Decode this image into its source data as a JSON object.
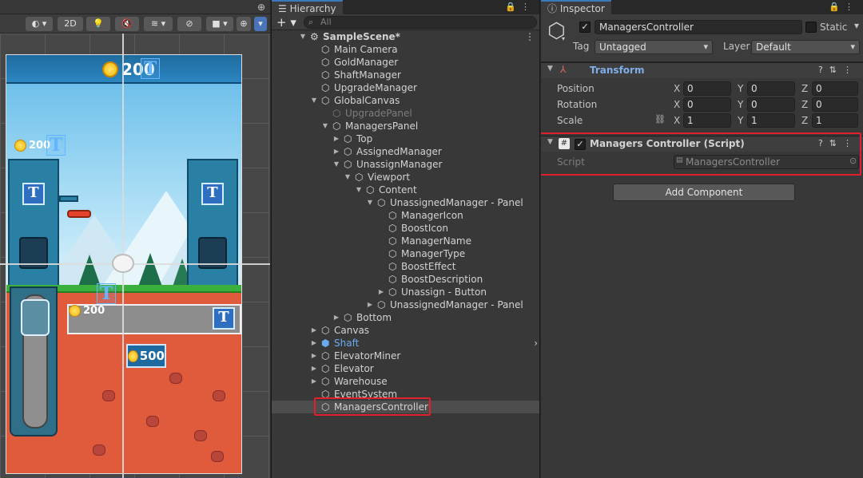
{
  "scene": {
    "tools": {
      "mode_2d": "2D"
    },
    "game": {
      "top_gold": "200",
      "left_gold": "200",
      "tunnel_gold": "200",
      "lower_gold": "500",
      "level_badge": "T",
      "text_glyph": "T"
    }
  },
  "hierarchy": {
    "tab_label": "Hierarchy",
    "add_label": "+",
    "search_placeholder": "All",
    "items": [
      {
        "label": "SampleScene*"
      },
      {
        "label": "Main Camera"
      },
      {
        "label": "GoldManager"
      },
      {
        "label": "ShaftManager"
      },
      {
        "label": "UpgradeManager"
      },
      {
        "label": "GlobalCanvas"
      },
      {
        "label": "UpgradePanel"
      },
      {
        "label": "ManagersPanel"
      },
      {
        "label": "Top"
      },
      {
        "label": "AssignedManager"
      },
      {
        "label": "UnassignManager"
      },
      {
        "label": "Viewport"
      },
      {
        "label": "Content"
      },
      {
        "label": "UnassignedManager - Panel"
      },
      {
        "label": "ManagerIcon"
      },
      {
        "label": "BoostIcon"
      },
      {
        "label": "ManagerName"
      },
      {
        "label": "ManagerType"
      },
      {
        "label": "BoostEffect"
      },
      {
        "label": "BoostDescription"
      },
      {
        "label": "Unassign - Button"
      },
      {
        "label": "UnassignedManager - Panel"
      },
      {
        "label": "Bottom"
      },
      {
        "label": "Canvas"
      },
      {
        "label": "Shaft"
      },
      {
        "label": "ElevatorMiner"
      },
      {
        "label": "Elevator"
      },
      {
        "label": "Warehouse"
      },
      {
        "label": "EventSystem"
      },
      {
        "label": "ManagersController"
      }
    ]
  },
  "inspector": {
    "tab_label": "Inspector",
    "object_name": "ManagersController",
    "static_label": "Static",
    "tag_label": "Tag",
    "tag_value": "Untagged",
    "layer_label": "Layer",
    "layer_value": "Default",
    "transform": {
      "title": "Transform",
      "position_label": "Position",
      "rotation_label": "Rotation",
      "scale_label": "Scale",
      "x_label": "X",
      "y_label": "Y",
      "z_label": "Z",
      "position": [
        "0",
        "0",
        "0"
      ],
      "rotation": [
        "0",
        "0",
        "0"
      ],
      "scale": [
        "1",
        "1",
        "1"
      ]
    },
    "script_component": {
      "title": "Managers Controller (Script)",
      "script_label": "Script",
      "script_value": "ManagersController"
    },
    "add_component": "Add Component"
  },
  "colors": {
    "accent": "#3a79bb",
    "highlight": "#e0202a",
    "shaft_text": "#6aabf0"
  }
}
